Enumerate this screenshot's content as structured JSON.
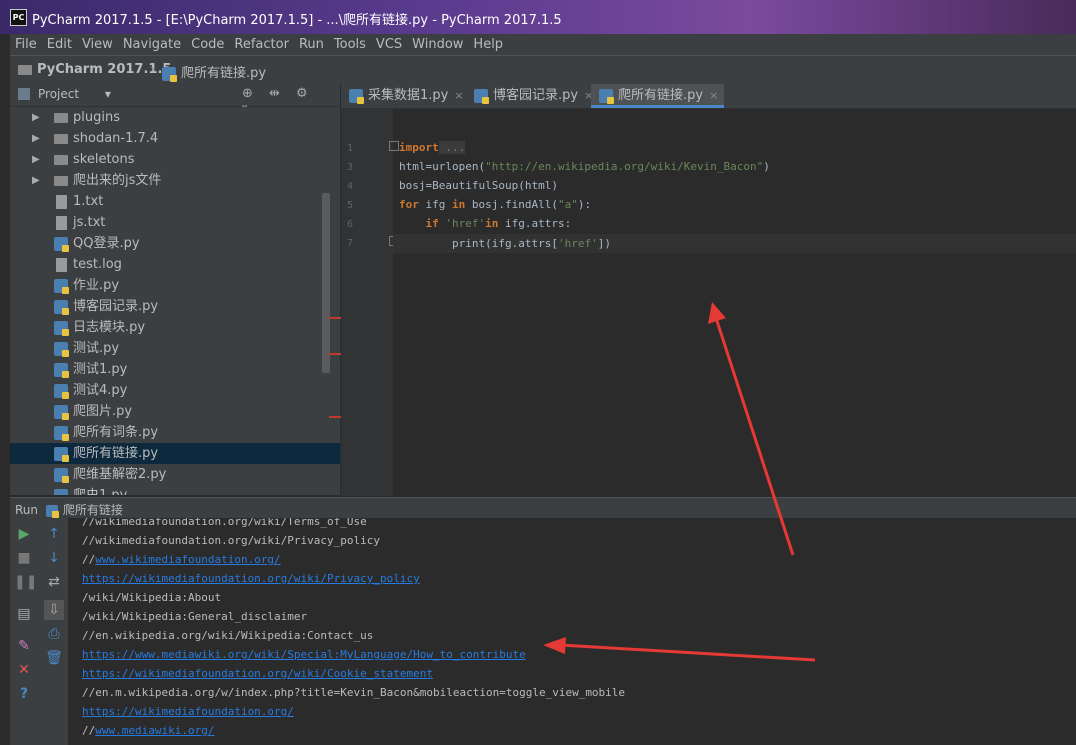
{
  "window": {
    "logo": "PC",
    "title": "PyCharm 2017.1.5 - [E:\\PyCharm 2017.1.5] - ...\\爬所有链接.py - PyCharm 2017.1.5"
  },
  "menu": [
    "File",
    "Edit",
    "View",
    "Navigate",
    "Code",
    "Refactor",
    "Run",
    "Tools",
    "VCS",
    "Window",
    "Help"
  ],
  "breadcrumb": {
    "project": "PyCharm 2017.1.5",
    "separator": "›",
    "file": "爬所有链接.py"
  },
  "project_panel": {
    "label": "Project",
    "dropdown": "▾",
    "tools": "⊕ ⇹ ⚙ ⇤",
    "items": [
      {
        "label": "plugins",
        "type": "folder",
        "arrow": "▶"
      },
      {
        "label": "shodan-1.7.4",
        "type": "folder",
        "arrow": "▶"
      },
      {
        "label": "skeletons",
        "type": "folder",
        "arrow": "▶"
      },
      {
        "label": "爬出来的js文件",
        "type": "folder",
        "arrow": "▶"
      },
      {
        "label": "1.txt",
        "type": "text"
      },
      {
        "label": "js.txt",
        "type": "text"
      },
      {
        "label": "QQ登录.py",
        "type": "py"
      },
      {
        "label": "test.log",
        "type": "text"
      },
      {
        "label": "作业.py",
        "type": "py"
      },
      {
        "label": "博客园记录.py",
        "type": "py"
      },
      {
        "label": "日志模块.py",
        "type": "py"
      },
      {
        "label": "测试.py",
        "type": "py"
      },
      {
        "label": "测试1.py",
        "type": "py"
      },
      {
        "label": "测试4.py",
        "type": "py"
      },
      {
        "label": "爬图片.py",
        "type": "py"
      },
      {
        "label": "爬所有词条.py",
        "type": "py"
      },
      {
        "label": "爬所有链接.py",
        "type": "py",
        "selected": true
      },
      {
        "label": "爬维基解密2.py",
        "type": "py"
      },
      {
        "label": "爬虫1.py",
        "type": "py"
      }
    ]
  },
  "tabs": [
    {
      "label": "采集数据1.py",
      "close": "×"
    },
    {
      "label": "博客园记录.py",
      "close": "×"
    },
    {
      "label": "爬所有链接.py",
      "close": "×",
      "active": true
    }
  ],
  "editor": {
    "line_numbers": [
      "1",
      "3",
      "4",
      "5",
      "6",
      "7"
    ],
    "code": {
      "l1_kw": "import",
      "l1_fold": " ...",
      "l3_a": "html=urlopen(",
      "l3_str": "\"http://en.wikipedia.org/wiki/Kevin_Bacon\"",
      "l3_b": ")",
      "l4": "bosj=BeautifulSoup(html)",
      "l5_kw1": "for",
      "l5_a": " ifg ",
      "l5_kw2": "in",
      "l5_b": " bosj.findAll(",
      "l5_str": "\"a\"",
      "l5_c": "):",
      "l6_indent": "    ",
      "l6_kw1": "if",
      "l6_str": " 'href'",
      "l6_kw2": "in",
      "l6_b": " ifg.attrs:",
      "l7_a": "        print(ifg.attrs[",
      "l7_str": "'href'",
      "l7_b": "])"
    }
  },
  "run_panel": {
    "label": "Run",
    "config": "爬所有链接",
    "lines": [
      {
        "text": "//wikimediafoundation.org/wiki/Terms_of_Use",
        "link": false
      },
      {
        "text": "//wikimediafoundation.org/wiki/Privacy_policy",
        "link": false
      },
      {
        "prefix": "//",
        "text": "www.wikimediafoundation.org/",
        "link": true
      },
      {
        "text": "https://wikimediafoundation.org/wiki/Privacy_policy",
        "link": true
      },
      {
        "text": "/wiki/Wikipedia:About",
        "link": false
      },
      {
        "text": "/wiki/Wikipedia:General_disclaimer",
        "link": false
      },
      {
        "text": "//en.wikipedia.org/wiki/Wikipedia:Contact_us",
        "link": false
      },
      {
        "text": "https://www.mediawiki.org/wiki/Special:MyLanguage/How_to_contribute",
        "link": true
      },
      {
        "text": "https://wikimediafoundation.org/wiki/Cookie_statement",
        "link": true
      },
      {
        "text": "//en.m.wikipedia.org/w/index.php?title=Kevin_Bacon&mobileaction=toggle_view_mobile",
        "link": false
      },
      {
        "text": "https://wikimediafoundation.org/",
        "link": true
      },
      {
        "prefix": "//",
        "text": "www.mediawiki.org/",
        "link": true
      }
    ]
  },
  "colors": {
    "accent": "#4a88c7",
    "annotation_arrow": "#e53935",
    "link": "#287bde"
  }
}
